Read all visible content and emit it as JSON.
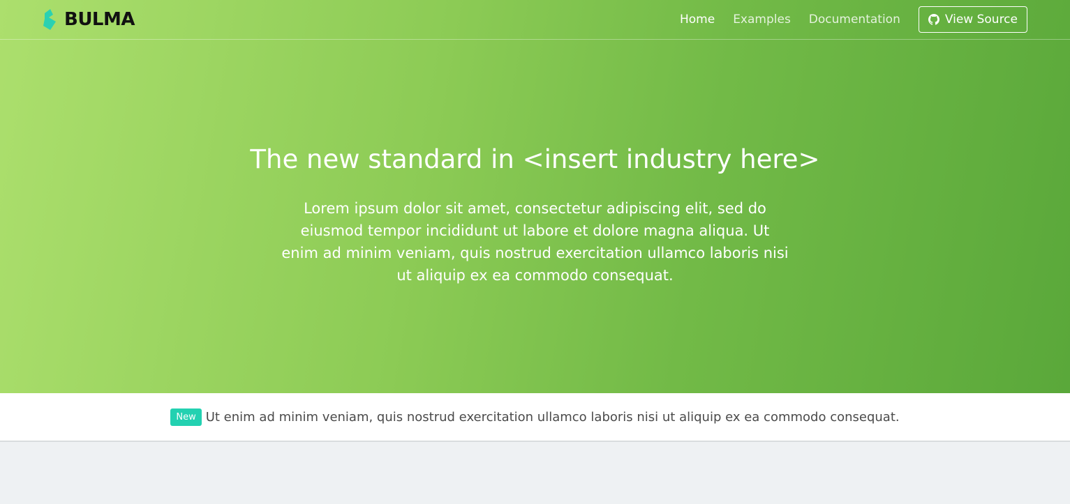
{
  "brand": {
    "name": "BULMA",
    "logo_color": "#2ad1b2"
  },
  "nav": {
    "items": [
      {
        "label": "Home",
        "active": true
      },
      {
        "label": "Examples",
        "active": false
      },
      {
        "label": "Documentation",
        "active": false
      }
    ],
    "source_button": {
      "label": "View Source",
      "icon": "github-icon"
    }
  },
  "hero": {
    "title": "The new standard in <insert industry here>",
    "subtitle": "Lorem ipsum dolor sit amet, consectetur adipiscing elit, sed do eiusmod tempor incididunt ut labore et dolore magna aliqua. Ut enim ad minim veniam, quis nostrud exercitation ullamco laboris nisi ut aliquip ex ea commodo consequat.",
    "gradient_start": "#acdf6d",
    "gradient_end": "#5aa83a"
  },
  "announcement": {
    "tag": "New",
    "tag_color": "#23d1b1",
    "text": "Ut enim ad minim veniam, quis nostrud exercitation ullamco laboris nisi ut aliquip ex ea commodo consequat."
  }
}
